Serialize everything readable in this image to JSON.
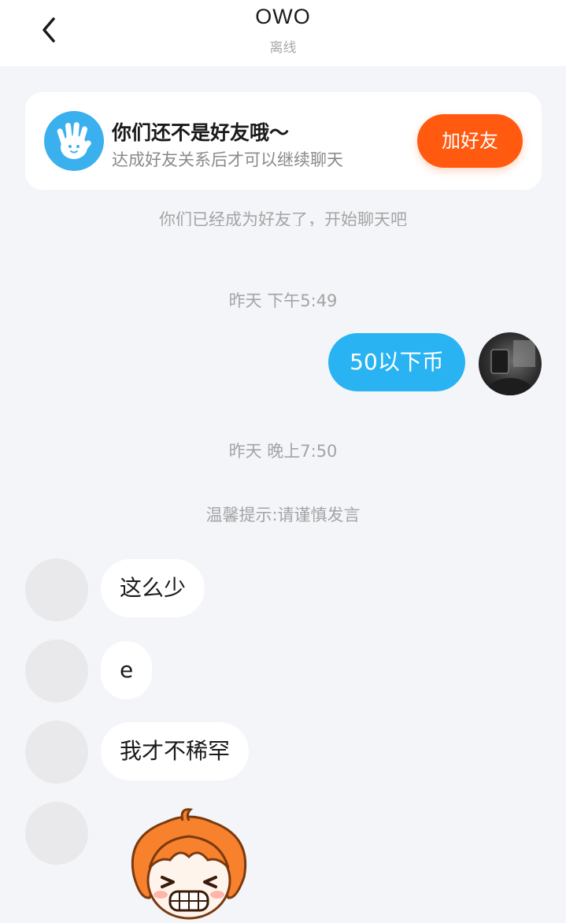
{
  "header": {
    "back_icon": "chevron-left-icon",
    "title": "OWO",
    "status": "离线"
  },
  "banner": {
    "icon": "waving-hand-icon",
    "title": "你们还不是好友哦～",
    "description": "达成好友关系后才可以继续聊天",
    "add_button": "加好友",
    "accent_color": "#ff5a10"
  },
  "messages": {
    "hidden_notice": "你们已经成为好友了，开始聊天吧",
    "time_1": "昨天 下午5:49",
    "outgoing_1": "50以下币",
    "time_2": "昨天 晚上7:50",
    "tip": "温馨提示:请谨慎发言",
    "incoming": [
      "这么少",
      "e",
      "我才不稀罕"
    ],
    "sticker": "angry-orange-haired-face-sticker"
  },
  "colors": {
    "outgoing_bubble": "#29b3f2",
    "background": "#f4f5f9"
  }
}
